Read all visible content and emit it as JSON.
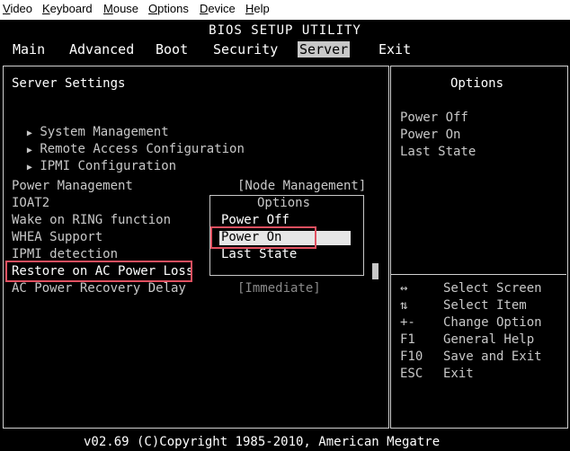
{
  "menubar": {
    "items": [
      "Video",
      "Keyboard",
      "Mouse",
      "Options",
      "Device",
      "Help"
    ]
  },
  "bios": {
    "title": "BIOS SETUP UTILITY",
    "tabs": [
      "Main",
      "Advanced",
      "Boot",
      "Security",
      "Server",
      "Exit"
    ],
    "active_tab": "Server",
    "left_header": "Server Settings",
    "submenus": [
      "System Management",
      "Remote Access Configuration",
      "IPMI Configuration"
    ],
    "settings": [
      {
        "label": "Power Management",
        "value": "[Node Management]"
      },
      {
        "label": "IOAT2",
        "value": ""
      },
      {
        "label": "Wake on RING function",
        "value": ""
      },
      {
        "label": "WHEA Support",
        "value": ""
      },
      {
        "label": "IPMI detection",
        "value": ""
      },
      {
        "label": "Restore on AC Power Loss",
        "value": ""
      },
      {
        "label": "AC Power Recovery Delay",
        "value": "[Immediate]"
      }
    ],
    "right_header": "Options",
    "right_options": [
      "Power Off",
      "Power On",
      "Last State"
    ],
    "popup": {
      "title": "Options",
      "items": [
        "Power Off",
        "Power On",
        "Last State"
      ],
      "selected_index": 1
    },
    "keys": [
      {
        "key": "↔",
        "desc": "Select Screen"
      },
      {
        "key": "⇅",
        "desc": "Select Item"
      },
      {
        "key": "+-",
        "desc": "Change Option"
      },
      {
        "key": "F1",
        "desc": "General Help"
      },
      {
        "key": "F10",
        "desc": "Save and Exit"
      },
      {
        "key": "ESC",
        "desc": "Exit"
      }
    ],
    "footer": "v02.69 (C)Copyright 1985-2010, American Megatre",
    "submenu_arrow": "▶"
  },
  "colors": {
    "background": "#000000",
    "text": "#c8c8c8",
    "active_tab_bg": "#c8c8c8",
    "highlight_box": "#e05060"
  }
}
